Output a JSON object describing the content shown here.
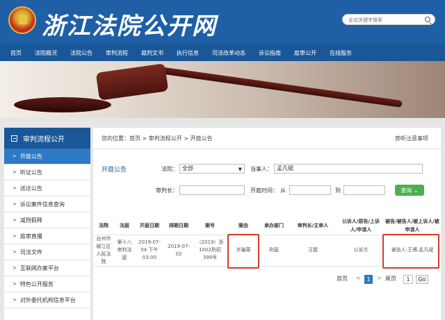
{
  "site": {
    "title": "浙江法院公开网",
    "search_placeholder": "全站关键字搜索"
  },
  "nav": [
    "首页",
    "法院概况",
    "法院公告",
    "审判流程",
    "裁判文书",
    "执行信息",
    "司法改革动态",
    "诉讼指南",
    "庭审公开",
    "在线服务"
  ],
  "sidebar": {
    "title": "审判流程公开",
    "items": [
      {
        "label": "开庭公告",
        "active": true
      },
      {
        "label": "听证公告"
      },
      {
        "label": "送达公告"
      },
      {
        "label": "诉讼案件信息查询"
      },
      {
        "label": "减刑假释"
      },
      {
        "label": "庭审直播"
      },
      {
        "label": "司法文件"
      },
      {
        "label": "互联网办案平台"
      },
      {
        "label": "特色公开服务"
      },
      {
        "label": "对外委托机构信息平台"
      }
    ]
  },
  "breadcrumb": "您的位置：首页 > 审判流程公开 > 开庭公告",
  "notice_link": "旁听注意事项",
  "filter": {
    "section_title": "开庭公告",
    "court_label": "法院：",
    "court_value": "全部",
    "party_label": "当事人：",
    "party_value": "孟凡斌",
    "judge_label": "审判长：",
    "date_label": "开庭时间：",
    "from_label": "从",
    "to_label": "到",
    "query_button": "查询"
  },
  "table": {
    "headers": [
      "法院",
      "法庭",
      "开庭日期",
      "排期日期",
      "案号",
      "案由",
      "承办部门",
      "审判长/主审人",
      "公诉人/原告/上诉人/申请人",
      "被告/被告人/被上诉人/被申请人"
    ],
    "rows": [
      [
        "台州市椒江区人民法院",
        "第十八审判法庭",
        "2019-07-04 下午03:00",
        "2019-07-02",
        "（2019）浙1002刑初398号",
        "诈骗罪",
        "刑庭",
        "汪霞",
        "公诉方",
        "被告人:王博,孟凡斌"
      ]
    ]
  },
  "pager": {
    "first": "首页",
    "current": "1",
    "last": "尾页",
    "goto_value": "1",
    "go_label": "Go"
  }
}
